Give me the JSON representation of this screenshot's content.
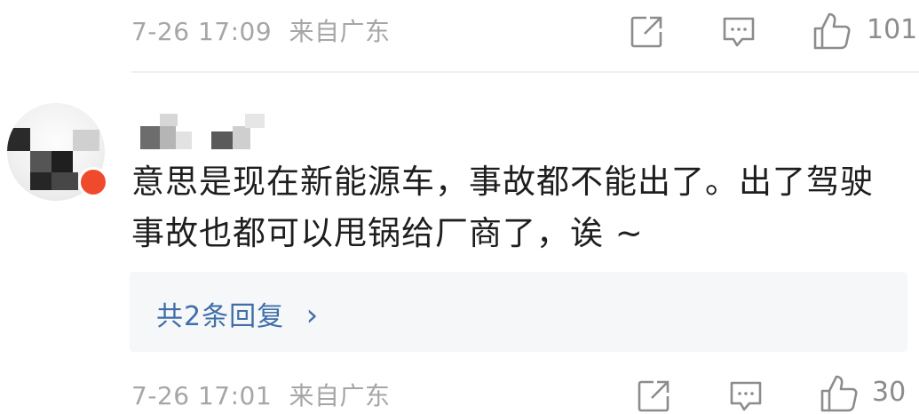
{
  "comment_prev": {
    "timestamp": "7-26 17:09",
    "location": "来自广东",
    "like_count": "101",
    "icons": [
      "share-icon",
      "reply-icon",
      "like-icon"
    ]
  },
  "comment_main": {
    "username_obscured": true,
    "avatar": {
      "badge_color": "#f04a2d"
    },
    "text": "意思是现在新能源车，事故都不能出了。出了驾驶事故也都可以甩锅给厂商了，诶 ~",
    "replies_label": "共2条回复",
    "replies_chevron": "›",
    "timestamp": "7-26 17:01",
    "location": "来自广东",
    "like_count": "30",
    "icons": [
      "share-icon",
      "reply-icon",
      "like-icon"
    ]
  },
  "colors": {
    "meta_text": "#a6a6a6",
    "reply_link": "#3f6ea8",
    "reply_bg": "#f6f7f9",
    "divider": "#f0f0f0"
  }
}
